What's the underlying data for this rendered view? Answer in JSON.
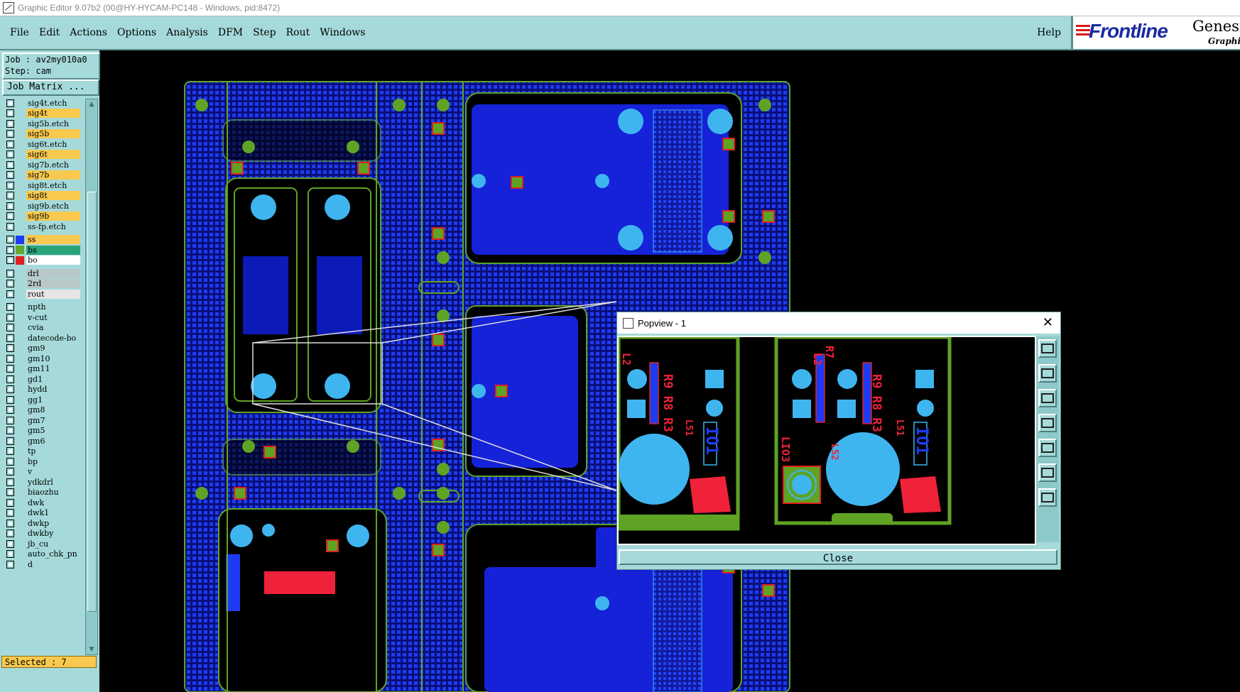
{
  "window": {
    "title": "Graphic Editor 9.07b2 (00@HY-HYCAM-PC148 - Windows, pid:8472)"
  },
  "menu": {
    "items": [
      "File",
      "Edit",
      "Actions",
      "Options",
      "Analysis",
      "DFM",
      "Step",
      "Rout",
      "Windows"
    ],
    "help": "Help"
  },
  "logo": {
    "brand": "Frontline",
    "product": "Genesis",
    "subtitle": "Graphic"
  },
  "job": {
    "label": "Job : av2my010a0",
    "step": "Step: cam",
    "matrix_button": "Job Matrix ..."
  },
  "layers": [
    {
      "name": "sig4t.etch",
      "color": "#a6dada"
    },
    {
      "name": "sig4t",
      "color": "#f8c94e"
    },
    {
      "name": "sig5b.etch",
      "color": "#a6dada"
    },
    {
      "name": "sig5b",
      "color": "#f8c94e"
    },
    {
      "name": "sig6t.etch",
      "color": "#a6dada"
    },
    {
      "name": "sig6t",
      "color": "#f8c94e"
    },
    {
      "name": "sig7b.etch",
      "color": "#a6dada"
    },
    {
      "name": "sig7b",
      "color": "#f8c94e"
    },
    {
      "name": "sig8t.etch",
      "color": "#a6dada"
    },
    {
      "name": "sig8t",
      "color": "#f8c94e"
    },
    {
      "name": "sig9b.etch",
      "color": "#a6dada"
    },
    {
      "name": "sig9b",
      "color": "#f8c94e"
    },
    {
      "name": "ss-fp.etch",
      "color": "#a6dada"
    },
    {
      "name": "ss",
      "color": "#f8c94e",
      "swatch": "#1f3cf0",
      "gap": true
    },
    {
      "name": "bs",
      "color": "#2aa37b",
      "swatch": "#62a82a"
    },
    {
      "name": "bo",
      "color": "#ffffff",
      "swatch": "#e02020",
      "special": true
    },
    {
      "name": "drl",
      "color": "#b8c8c8",
      "gap": true
    },
    {
      "name": "2rd",
      "color": "#b8c8c8"
    },
    {
      "name": "rout",
      "color": "#e6e6e6"
    },
    {
      "name": "npth",
      "color": "#a6dada",
      "gap": true
    },
    {
      "name": "v-cut",
      "color": "#a6dada"
    },
    {
      "name": "cvia",
      "color": "#a6dada"
    },
    {
      "name": "datecode-bo",
      "color": "#a6dada"
    },
    {
      "name": "gm9",
      "color": "#a6dada"
    },
    {
      "name": "gm10",
      "color": "#a6dada"
    },
    {
      "name": "gm11",
      "color": "#a6dada"
    },
    {
      "name": "gd1",
      "color": "#a6dada"
    },
    {
      "name": "hydd",
      "color": "#a6dada"
    },
    {
      "name": "gg1",
      "color": "#a6dada"
    },
    {
      "name": "gm8",
      "color": "#a6dada"
    },
    {
      "name": "gm7",
      "color": "#a6dada"
    },
    {
      "name": "gm5",
      "color": "#a6dada"
    },
    {
      "name": "gm6",
      "color": "#a6dada"
    },
    {
      "name": "tp",
      "color": "#a6dada"
    },
    {
      "name": "bp",
      "color": "#a6dada"
    },
    {
      "name": "v",
      "color": "#a6dada"
    },
    {
      "name": "ydkdrl",
      "color": "#a6dada"
    },
    {
      "name": "biaozhu",
      "color": "#a6dada"
    },
    {
      "name": "dwk",
      "color": "#a6dada"
    },
    {
      "name": "dwk1",
      "color": "#a6dada"
    },
    {
      "name": "dwkp",
      "color": "#a6dada"
    },
    {
      "name": "dwkby",
      "color": "#a6dada"
    },
    {
      "name": "jb_cu",
      "color": "#a6dada"
    },
    {
      "name": "auto_chk_pn",
      "color": "#a6dada"
    },
    {
      "name": "d",
      "color": "#a6dada"
    }
  ],
  "status": {
    "selected": "Selected : 7"
  },
  "popview": {
    "title": "Popview - 1",
    "close_button": "Close",
    "board_text_left": [
      "R9 R8 R3",
      "L2",
      "IO1",
      "L51"
    ],
    "board_text_right": [
      "R9 R8 R3",
      "L2",
      "IO1",
      "L51",
      "L52",
      "R7",
      "LIO3"
    ]
  },
  "colors": {
    "panel": "#a6dada",
    "board_blue": "#1522d8",
    "copper_green": "#5fa324",
    "pad_cyan": "#3fb5f0",
    "silk_red": "#f0223a"
  },
  "icons": [
    "window-app-icon",
    "popview-app-icon",
    "close-icon",
    "zoom-in-icon",
    "zoom-out-icon",
    "pan-up-icon",
    "pan-left-icon",
    "pan-right-icon",
    "fit-icon",
    "zoom-home-icon"
  ]
}
